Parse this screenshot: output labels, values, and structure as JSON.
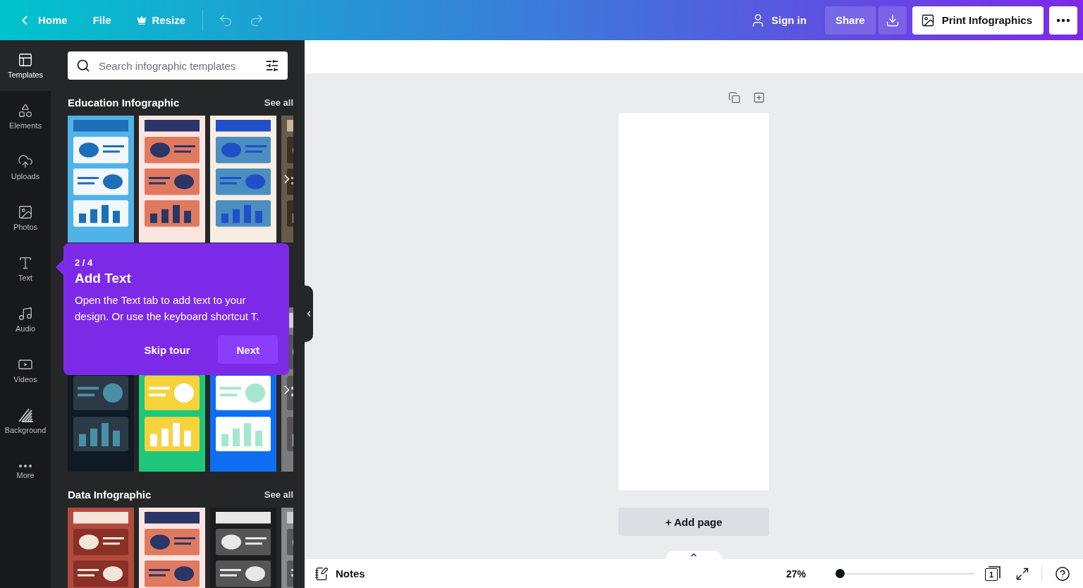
{
  "topbar": {
    "home": "Home",
    "file": "File",
    "resize": "Resize",
    "sign_in": "Sign in",
    "share": "Share",
    "print": "Print Infographics"
  },
  "sidebar": {
    "items": [
      {
        "kind": "templates",
        "label": "Templates",
        "selected": true
      },
      {
        "kind": "elements",
        "label": "Elements",
        "selected": false
      },
      {
        "kind": "uploads",
        "label": "Uploads",
        "selected": false
      },
      {
        "kind": "photos",
        "label": "Photos",
        "selected": false
      },
      {
        "kind": "text",
        "label": "Text",
        "selected": false
      },
      {
        "kind": "audio",
        "label": "Audio",
        "selected": false
      },
      {
        "kind": "videos",
        "label": "Videos",
        "selected": false
      },
      {
        "kind": "background",
        "label": "Background",
        "selected": false
      },
      {
        "kind": "more",
        "label": "More",
        "selected": false
      }
    ]
  },
  "search": {
    "placeholder": "Search infographic templates"
  },
  "sections": [
    {
      "title": "Education Infographic",
      "see_all": "See all",
      "thumbnails": [
        {
          "kind": "picture"
        },
        {
          "kind": "picture"
        },
        {
          "kind": "picture"
        },
        {
          "kind": "picture"
        }
      ]
    },
    {
      "thumbnails": [
        {
          "kind": "picture"
        },
        {
          "kind": "picture"
        },
        {
          "kind": "picture"
        },
        {
          "kind": "picture"
        }
      ]
    },
    {
      "title": "Data Infographic",
      "see_all": "See all",
      "thumbnails": [
        {
          "kind": "picture"
        },
        {
          "kind": "picture"
        },
        {
          "kind": "picture"
        },
        {
          "kind": "picture"
        }
      ]
    }
  ],
  "tour": {
    "step": "2 / 4",
    "title": "Add Text",
    "body": "Open the Text tab to add text to your design. Or use the keyboard shortcut T.",
    "skip": "Skip tour",
    "next": "Next"
  },
  "canvas": {
    "add_page": "+ Add page"
  },
  "bottom_bar": {
    "notes": "Notes",
    "zoom": "27%",
    "zoom_slider": {
      "level": 0
    },
    "page_count": "1"
  }
}
